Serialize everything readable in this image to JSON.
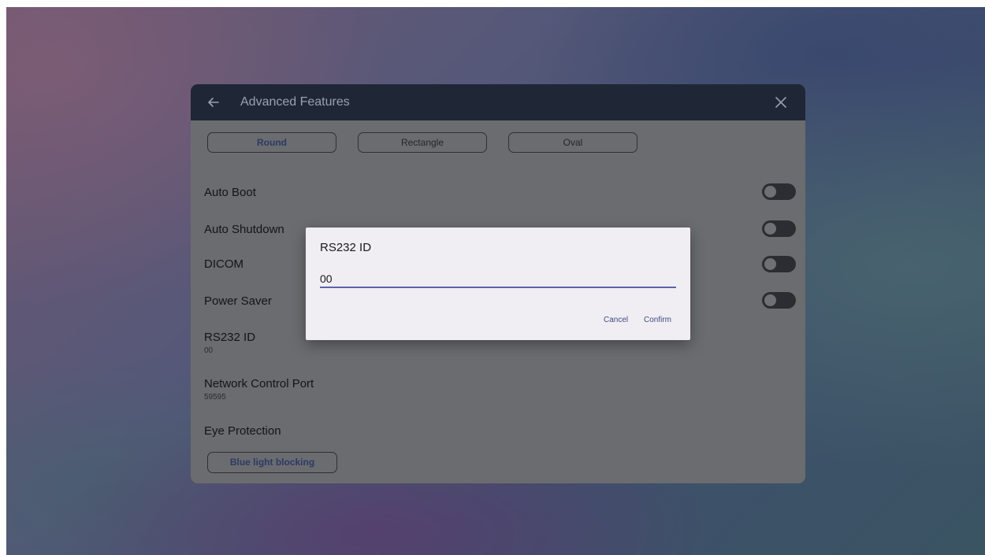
{
  "header": {
    "title": "Advanced Features",
    "back_icon": "arrow-left-icon",
    "close_icon": "close-icon"
  },
  "shape_options": {
    "round": "Round",
    "rectangle": "Rectangle",
    "oval": "Oval",
    "selected": "Round"
  },
  "settings": {
    "auto_boot": {
      "label": "Auto Boot",
      "enabled": false
    },
    "auto_shutdown": {
      "label": "Auto Shutdown",
      "enabled": false
    },
    "dicom": {
      "label": "DICOM",
      "enabled": false
    },
    "power_saver": {
      "label": "Power Saver",
      "enabled": false
    },
    "rs232_id": {
      "label": "RS232 ID",
      "value": "00"
    },
    "network_control_port": {
      "label": "Network Control Port",
      "value": "59595"
    },
    "eye_protection": {
      "label": "Eye Protection",
      "option": "Blue light blocking"
    }
  },
  "dialog": {
    "title": "RS232 ID",
    "input_value": "00",
    "cancel_label": "Cancel",
    "confirm_label": "Confirm"
  },
  "colors": {
    "header_bg": "#1f2736",
    "panel_bg": "#6b6c6f",
    "accent": "#5d63a6",
    "dialog_bg": "#f1eef3",
    "dialog_button_text": "#3a4c84"
  }
}
